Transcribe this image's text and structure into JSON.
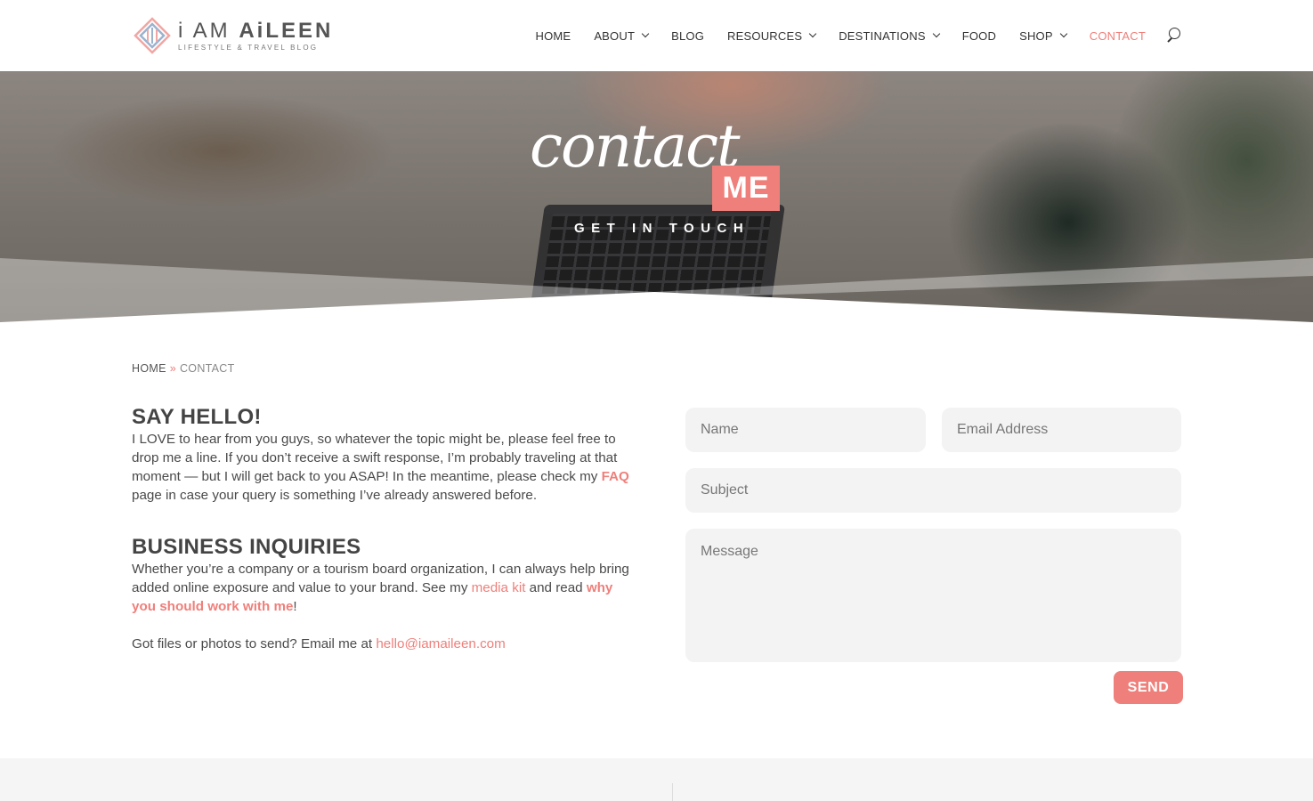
{
  "brand": {
    "name_light": "i AM ",
    "name_bold": "AiLEEN",
    "tagline": "LIFESTYLE & TRAVEL BLOG",
    "accent_color": "#ef7f7a"
  },
  "nav": {
    "items": [
      {
        "label": "HOME",
        "has_dropdown": false
      },
      {
        "label": "ABOUT",
        "has_dropdown": true
      },
      {
        "label": "BLOG",
        "has_dropdown": false
      },
      {
        "label": "RESOURCES",
        "has_dropdown": true
      },
      {
        "label": "DESTINATIONS",
        "has_dropdown": true
      },
      {
        "label": "FOOD",
        "has_dropdown": false
      },
      {
        "label": "SHOP",
        "has_dropdown": true
      },
      {
        "label": "CONTACT",
        "has_dropdown": false,
        "active": true
      }
    ],
    "search_icon": "search-icon"
  },
  "hero": {
    "script_text": "contact",
    "badge_text": "ME",
    "subtitle": "GET IN TOUCH"
  },
  "breadcrumb": {
    "home": "HOME",
    "separator": "»",
    "current": "CONTACT"
  },
  "say_hello": {
    "heading": "SAY HELLO!",
    "text_before": "I LOVE to hear from you guys, so whatever the topic might be, please feel free to drop me a line. If you don’t receive a swift response, I’m probably traveling at that moment — but I will get back to you ASAP! In the meantime, please check my ",
    "faq_link": "FAQ",
    "text_after": " page in case your query is something I’ve already answered before."
  },
  "business": {
    "heading": "BUSINESS INQUIRIES",
    "text_before": "Whether you’re a company or a tourism board organization, I can always help bring added online exposure and value to your brand. See my ",
    "media_kit_link": "media kit",
    "text_middle": " and read ",
    "work_link": "why you should work with me",
    "text_after": "!",
    "files_text": "Got files or photos to send? Email me at ",
    "email_link": "hello@iamaileen.com"
  },
  "form": {
    "name_placeholder": "Name",
    "email_placeholder": "Email Address",
    "subject_placeholder": "Subject",
    "message_placeholder": "Message",
    "send_label": "SEND"
  }
}
